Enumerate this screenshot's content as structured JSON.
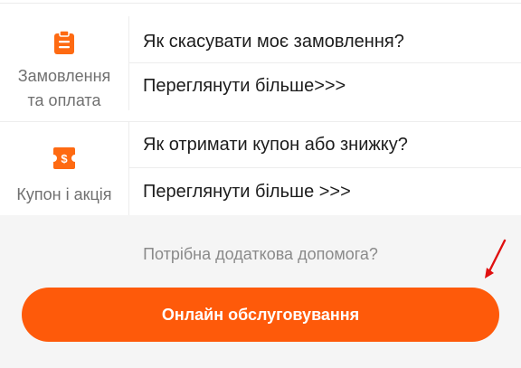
{
  "sections": [
    {
      "category": "Замовлення\nта оплата",
      "question": "Як скасувати моє замовлення?",
      "more": "Переглянути більше>>>"
    },
    {
      "category": "Купон і акція",
      "question": "Як отримати купон або знижку?",
      "more": "Переглянути більше >>>"
    }
  ],
  "help": {
    "prompt": "Потрібна додаткова допомога?",
    "button_label": "Онлайн обслуговування"
  },
  "colors": {
    "accent": "#fe5a0a",
    "annotation_arrow": "#e01010"
  },
  "icons": {
    "orders": "clipboard-icon",
    "coupon": "coupon-ticket-icon",
    "annotation": "red-arrow-icon"
  }
}
